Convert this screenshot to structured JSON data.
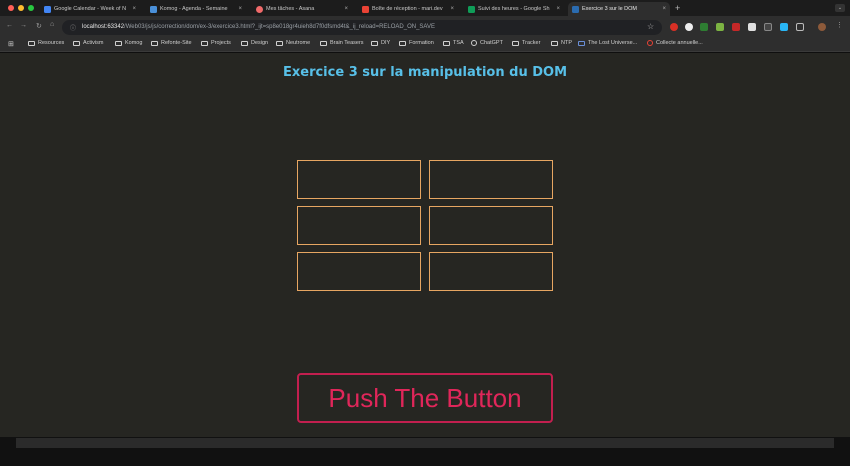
{
  "window_controls": {
    "close_color": "#ff5f57",
    "minimize_color": "#febc2e",
    "maximize_color": "#28c840"
  },
  "tabs": [
    {
      "label": "Google Calendar - Week of N",
      "icon_color": "#4285f4",
      "active": false
    },
    {
      "label": "Komog - Agenda - Semaine",
      "icon_color": "#4a90d9",
      "active": false
    },
    {
      "label": "Mes tâches - Asana",
      "icon_color": "#f06a6a",
      "active": false
    },
    {
      "label": "Boîte de réception - mari.dev",
      "icon_color": "#ea4335",
      "active": false
    },
    {
      "label": "Suivi des heures - Google Sh",
      "icon_color": "#0f9d58",
      "active": false
    },
    {
      "label": "Exercice 3 sur le DOM",
      "icon_color": "#2b6cb0",
      "active": true
    }
  ],
  "tab_close": "×",
  "new_tab": "+",
  "tab_menu": "⌄",
  "nav": {
    "back": "←",
    "forward": "→",
    "reload": "↻",
    "home": "⌂"
  },
  "address": {
    "host": "localhost:63342",
    "rest": "/Web03/js/js/correction/dom/ex-3/exercice3.html?_ijt=sp8e018gr4uieh8d7f0dfsmd4t&_ij_reload=RELOAD_ON_SAVE"
  },
  "bookmarks": [
    "Resources",
    "Activism",
    "Komog",
    "Refonte-Site",
    "Projects",
    "Design",
    "Neutrome",
    "Brain Teasers",
    "DIY",
    "Formation",
    "TSA",
    "ChatGPT",
    "Tracker",
    "NTP",
    "The Lost Universe...",
    "Collecte annuelle..."
  ],
  "page": {
    "title": "Exercice 3 sur la manipulation du DOM",
    "grid_rows": 3,
    "grid_cols": 2,
    "cell_border_color": "#e7a662",
    "button_label": "Push The Button",
    "button_color": "#e0265a"
  }
}
